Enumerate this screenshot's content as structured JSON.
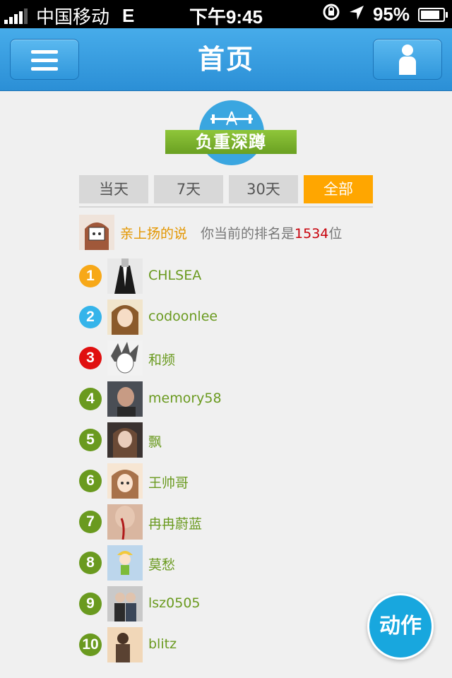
{
  "status": {
    "carrier": "中国移动",
    "network": "E",
    "time": "下午9:45",
    "battery": "95%"
  },
  "header": {
    "title": "首页"
  },
  "logo": {
    "text": "负重深蹲"
  },
  "tabs": [
    {
      "label": "当天",
      "active": false
    },
    {
      "label": "7天",
      "active": false
    },
    {
      "label": "30天",
      "active": false
    },
    {
      "label": "全部",
      "active": true
    }
  ],
  "my_rank": {
    "name": "亲上扬的说",
    "prefix": "你当前的排名是",
    "rank": "1534",
    "suffix": "位"
  },
  "ranking": [
    {
      "rank": "1",
      "name": "CHLSEA",
      "badge_color": "#f7a818"
    },
    {
      "rank": "2",
      "name": "codoonlee",
      "badge_color": "#35b4ea"
    },
    {
      "rank": "3",
      "name": "和频",
      "badge_color": "#e01010"
    },
    {
      "rank": "4",
      "name": "memory58",
      "badge_color": "#6a9a1f"
    },
    {
      "rank": "5",
      "name": "飘",
      "badge_color": "#6a9a1f"
    },
    {
      "rank": "6",
      "name": "王帅哥",
      "badge_color": "#6a9a1f"
    },
    {
      "rank": "7",
      "name": "冉冉蔚蓝",
      "badge_color": "#6a9a1f"
    },
    {
      "rank": "8",
      "name": "莫愁",
      "badge_color": "#6a9a1f"
    },
    {
      "rank": "9",
      "name": "lsz0505",
      "badge_color": "#6a9a1f"
    },
    {
      "rank": "10",
      "name": "blitz",
      "badge_color": "#6a9a1f"
    }
  ],
  "action_button": {
    "label": "动作"
  },
  "colors": {
    "accent": "#2b8fd6",
    "tab_active": "#ffa600",
    "name_green": "#6a9a1f"
  },
  "icons": {
    "menu": "menu-icon",
    "user": "user-icon"
  }
}
